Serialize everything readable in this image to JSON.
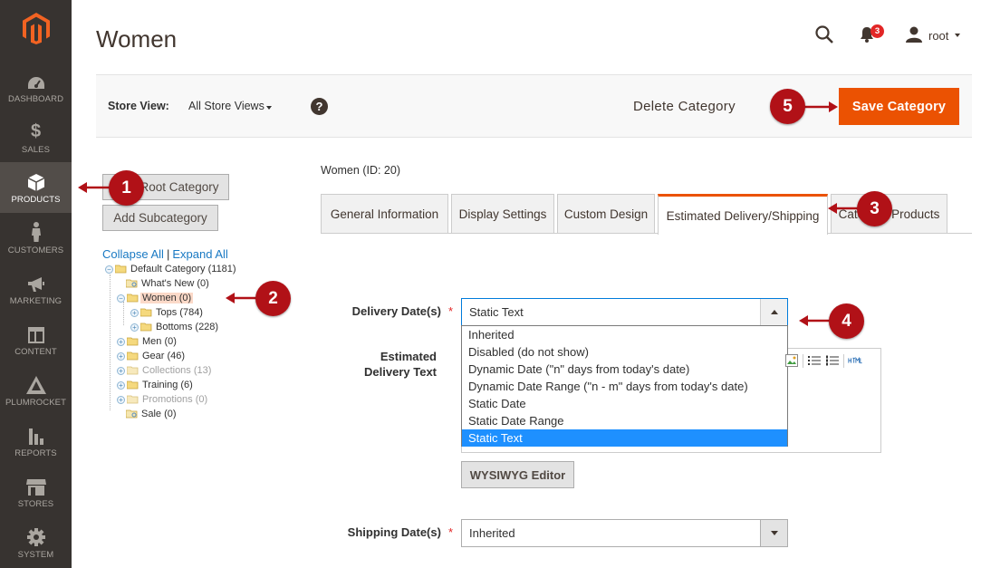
{
  "sidebar": {
    "items": [
      {
        "label": "DASHBOARD",
        "icon": "dashboard-icon"
      },
      {
        "label": "SALES",
        "icon": "dollar-icon"
      },
      {
        "label": "PRODUCTS",
        "icon": "box-icon"
      },
      {
        "label": "CUSTOMERS",
        "icon": "person-icon"
      },
      {
        "label": "MARKETING",
        "icon": "megaphone-icon"
      },
      {
        "label": "CONTENT",
        "icon": "layout-icon"
      },
      {
        "label": "PLUMROCKET",
        "icon": "plumrocket-icon"
      },
      {
        "label": "REPORTS",
        "icon": "bar-chart-icon"
      },
      {
        "label": "STORES",
        "icon": "store-icon"
      },
      {
        "label": "SYSTEM",
        "icon": "gear-icon"
      }
    ],
    "sales_glyph": "$"
  },
  "header": {
    "title": "Women",
    "notifications_count": "3",
    "user_name": "root"
  },
  "store_bar": {
    "label": "Store View:",
    "value": "All Store Views",
    "help": "?",
    "delete_label": "Delete Category",
    "save_label": "Save Category"
  },
  "tree_panel": {
    "root_button_label": "Root Category",
    "sub_button_label": "Add Subcategory",
    "collapse_label": "Collapse All",
    "separator": "|",
    "expand_label": "Expand All",
    "nodes": [
      {
        "label": "Default Category (1181)"
      },
      {
        "label": "What's New (0)"
      },
      {
        "label": "Women (0)"
      },
      {
        "label": "Tops (784)"
      },
      {
        "label": "Bottoms (228)"
      },
      {
        "label": "Men (0)"
      },
      {
        "label": "Gear (46)"
      },
      {
        "label": "Collections (13)"
      },
      {
        "label": "Training (6)"
      },
      {
        "label": "Promotions (0)"
      },
      {
        "label": "Sale (0)"
      }
    ]
  },
  "main": {
    "category_id": "Women (ID: 20)",
    "tabs": [
      {
        "label": "General Information"
      },
      {
        "label": "Display Settings"
      },
      {
        "label": "Custom Design"
      },
      {
        "label": "Estimated Delivery/Shipping"
      },
      {
        "label": "Category Products"
      }
    ],
    "delivery_label": "Delivery Date(s)",
    "delivery_value": "Static Text",
    "required_mark": "*",
    "delivery_options": [
      "Inherited",
      "Disabled (do not show)",
      "Dynamic Date (\"n\" days from today's date)",
      "Dynamic Date Range (\"n - m\" days from today's date)",
      "Static Date",
      "Static Date Range",
      "Static Text"
    ],
    "est_label_1": "Estimated",
    "est_label_2": "Delivery Text",
    "wysiwyg_label": "WYSIWYG Editor",
    "shipping_label": "Shipping Date(s)",
    "shipping_value": "Inherited"
  },
  "callouts": [
    "1",
    "2",
    "3",
    "4",
    "5"
  ],
  "colors": {
    "accent": "#eb5202",
    "sidebar_bg": "#373330",
    "callout": "#b11117",
    "selection": "#1e90ff"
  }
}
